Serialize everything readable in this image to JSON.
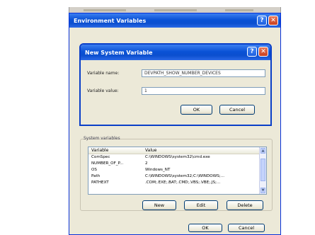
{
  "env_dialog": {
    "title": "Environment Variables",
    "help_glyph": "?",
    "close_glyph": "✕"
  },
  "new_var_dialog": {
    "title": "New System Variable",
    "help_glyph": "?",
    "close_glyph": "✕",
    "name_label": "Variable name:",
    "name_value": "DEVPATH_SHOW_NUMBER_DEVICES",
    "value_label": "Variable value:",
    "value_value": "1",
    "ok_label": "OK",
    "cancel_label": "Cancel"
  },
  "system_variables": {
    "section_label": "System variables",
    "columns": [
      "Variable",
      "Value"
    ],
    "rows": [
      {
        "variable": "ComSpec",
        "value": "C:\\WINDOWS\\system32\\cmd.exe"
      },
      {
        "variable": "NUMBER_OF_P...",
        "value": "2"
      },
      {
        "variable": "OS",
        "value": "Windows_NT"
      },
      {
        "variable": "Path",
        "value": "C:\\WINDOWS\\system32;C:\\WINDOWS;..."
      },
      {
        "variable": "PATHEXT",
        "value": ".COM;.EXE;.BAT;.CMD;.VBS;.VBE;.JS;..."
      }
    ],
    "new_label": "New",
    "edit_label": "Edit",
    "delete_label": "Delete"
  },
  "bottom_buttons": {
    "ok_label": "OK",
    "cancel_label": "Cancel"
  }
}
